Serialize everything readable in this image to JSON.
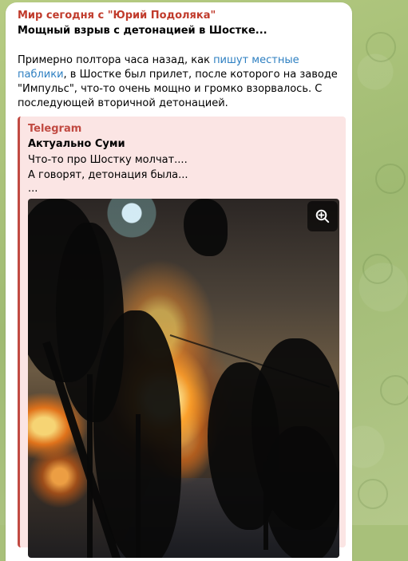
{
  "message": {
    "channel_name": "Мир сегодня с \"Юрий Подоляка\"",
    "headline": "Мощный взрыв с детонацией в Шостке...",
    "body_before_link": "Примерно полтора часа назад, как ",
    "body_link": "пишут местные паблики",
    "body_after_link": ", в Шостке был прилет, после которого на заводе \"Импульс\", что-то очень мощно и громко взорвалось. С последующей вторичной детонацией."
  },
  "forwarded": {
    "source": "Telegram",
    "title": "Актуально Суми",
    "line_1": "Что-то про Шостку молчат....",
    "line_2": "А говорят, детонация была...",
    "line_3": "..."
  },
  "photo": {
    "zoom_icon": "zoom-in-icon"
  },
  "colors": {
    "channel_accent": "#c03a2b",
    "link": "#2d7fc1",
    "forward_background": "#fbe5e4",
    "forward_border": "#c14a42"
  }
}
